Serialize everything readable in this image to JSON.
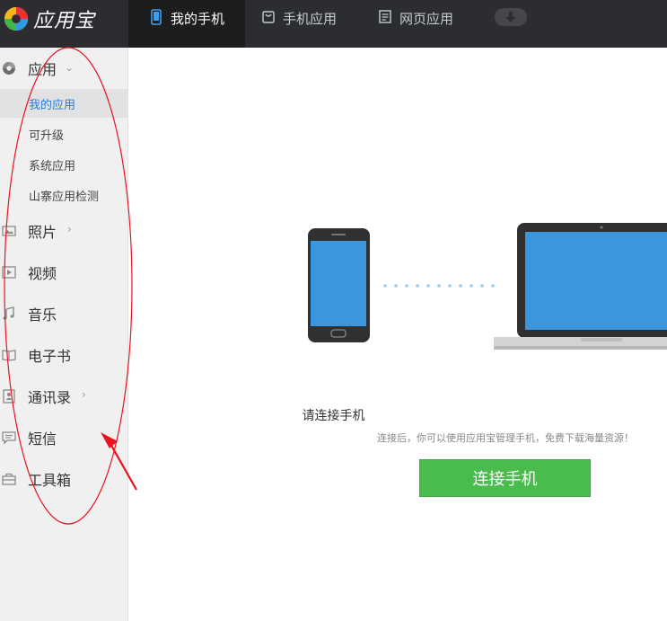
{
  "app": {
    "name": "应用宝"
  },
  "tabs": [
    {
      "label": "我的手机",
      "active": true
    },
    {
      "label": "手机应用",
      "active": false
    },
    {
      "label": "网页应用",
      "active": false
    }
  ],
  "sidebar": {
    "sections": [
      {
        "label": "应用",
        "icon": "apps-icon",
        "chevron": "down"
      },
      {
        "label": "照片",
        "icon": "photo-icon",
        "chevron": "right"
      },
      {
        "label": "视频",
        "icon": "video-icon"
      },
      {
        "label": "音乐",
        "icon": "music-icon"
      },
      {
        "label": "电子书",
        "icon": "ebook-icon"
      },
      {
        "label": "通讯录",
        "icon": "contacts-icon",
        "chevron": "right"
      },
      {
        "label": "短信",
        "icon": "sms-icon"
      },
      {
        "label": "工具箱",
        "icon": "toolbox-icon"
      }
    ],
    "app_subitems": [
      {
        "label": "我的应用",
        "active": true
      },
      {
        "label": "可升级",
        "active": false
      },
      {
        "label": "系统应用",
        "active": false
      },
      {
        "label": "山寨应用检测",
        "active": false
      }
    ]
  },
  "main": {
    "title": "请连接手机",
    "description": "连接后，你可以使用应用宝管理手机，免费下载海量资源！",
    "button_label": "连接手机"
  },
  "colors": {
    "topbar": "#2b2d30",
    "active_tab": "#1c1d1f",
    "accent_blue": "#2b7bd4",
    "screen_blue": "#3a96dd",
    "button_green": "#49bc4d",
    "annotation_red": "#e8141e"
  }
}
